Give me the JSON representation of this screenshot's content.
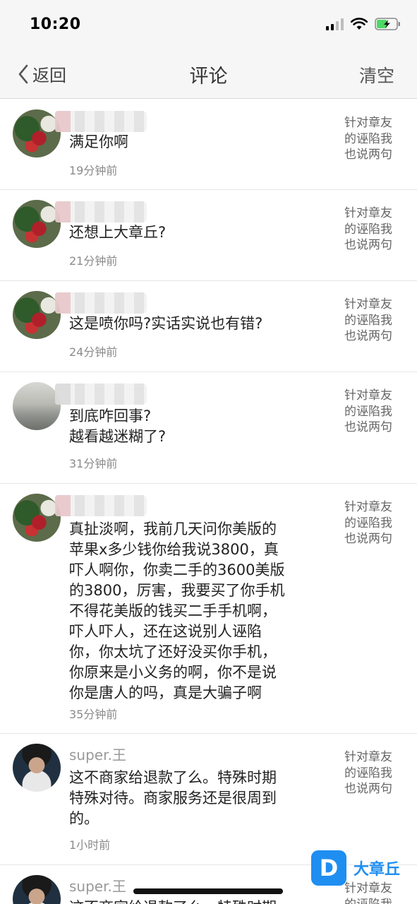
{
  "status": {
    "time": "10:20",
    "battery_color": "#4cd964"
  },
  "nav": {
    "back_label": "返回",
    "title": "评论",
    "clear_label": "清空"
  },
  "comments": [
    {
      "username": "",
      "text": "满足你啊",
      "time": "19分钟前",
      "reply_ref": "针对章友\n的诬陷我\n也说两句",
      "avatar": "flower"
    },
    {
      "username": "",
      "text": "还想上大章丘?",
      "time": "21分钟前",
      "reply_ref": "针对章友\n的诬陷我\n也说两句",
      "avatar": "flower"
    },
    {
      "username": "",
      "text": "这是喷你吗?实话实说也有错?",
      "time": "24分钟前",
      "reply_ref": "针对章友\n的诬陷我\n也说两句",
      "avatar": "flower"
    },
    {
      "username": "",
      "text": "到底咋回事?\n越看越迷糊了?",
      "time": "31分钟前",
      "reply_ref": "针对章友\n的诬陷我\n也说两句",
      "avatar": "garage"
    },
    {
      "username": "",
      "text": "真扯淡啊，我前几天问你美版的\n苹果x多少钱你给我说3800，真\n吓人啊你，你卖二手的3600美版\n的3800，厉害，我要买了你手机\n不得花美版的钱买二手手机啊，\n吓人吓人，还在这说别人诬陷\n你，你太坑了还好没买你手机，\n你原来是小义务的啊，你不是说\n你是唐人的吗，真是大骗子啊",
      "time": "35分钟前",
      "reply_ref": "针对章友\n的诬陷我\n也说两句",
      "avatar": "flower"
    },
    {
      "username": "super.王",
      "text": "这不商家给退款了么。特殊时期\n特殊对待。商家服务还是很周到\n的。",
      "time": "1小时前",
      "reply_ref": "针对章友\n的诬陷我\n也说两句",
      "avatar": "person"
    },
    {
      "username": "super.王",
      "text": "这不商家给退款了么。特殊时期",
      "time": "",
      "reply_ref": "针对章友\n的诬陷我",
      "avatar": "person"
    }
  ],
  "watermark": {
    "logo_letter": "D",
    "text": "大章丘"
  }
}
